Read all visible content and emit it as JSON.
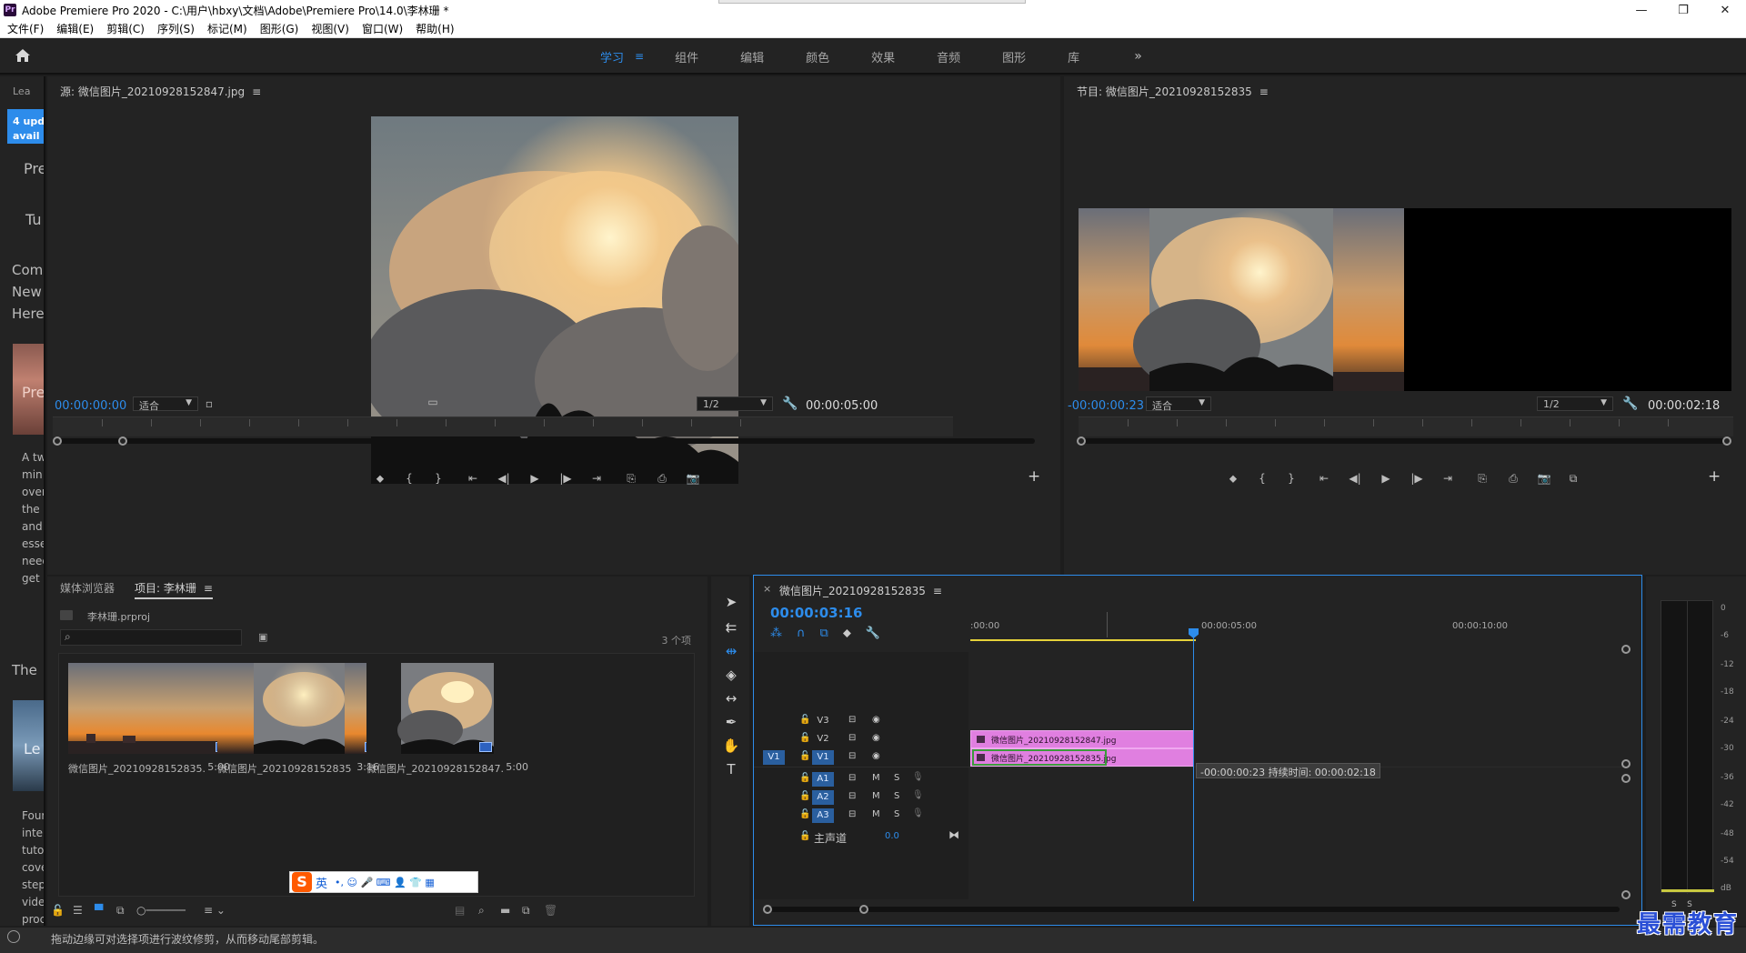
{
  "window": {
    "title": "Adobe Premiere Pro 2020 - C:\\用户\\hbxy\\文档\\Adobe\\Premiere Pro\\14.0\\李林珊 *",
    "app_icon": "Pr",
    "buttons": {
      "minimize": "—",
      "maximize": "❐",
      "close": "✕"
    }
  },
  "menubar": [
    "文件(F)",
    "编辑(E)",
    "剪辑(C)",
    "序列(S)",
    "标记(M)",
    "图形(G)",
    "视图(V)",
    "窗口(W)",
    "帮助(H)"
  ],
  "workspaces": {
    "home_icon": "home-icon",
    "tabs": [
      "学习",
      "组件",
      "编辑",
      "颜色",
      "效果",
      "音频",
      "图形",
      "库"
    ],
    "active": "学习",
    "active_menu": "≡",
    "more": "»"
  },
  "learn_panel": {
    "tab": "Lea",
    "updates_badge": "4 upd\navail",
    "texts": [
      "Pre",
      "Tu",
      "Com",
      "New",
      "Here",
      "Pre",
      "The",
      "Le"
    ],
    "desc1": "A tw\nmin\nover\nthe\nand\nesse\nneed\nget",
    "desc2": "Four\ninte\ntuto\ncove\nstep\nvide\nproc"
  },
  "source_monitor": {
    "title": "源: 微信图片_20210928152847.jpg",
    "menu": "≡",
    "timecode_in": "00:00:00:00",
    "fit": "适合",
    "resolution": "1/2",
    "duration": "00:00:05:00",
    "controls": [
      "⬥",
      "{",
      "}",
      "⇤",
      "◀|",
      "▶",
      "|▶",
      "⇥",
      "⎘",
      "⎙",
      "📷"
    ],
    "add": "+"
  },
  "program_monitor": {
    "title": "节目: 微信图片_20210928152835",
    "menu": "≡",
    "timecode_in": "-00:00:00:23",
    "fit": "适合",
    "resolution": "1/2",
    "duration": "00:00:02:18",
    "controls": [
      "⬥",
      "{",
      "}",
      "⇤",
      "◀|",
      "▶",
      "|▶",
      "⇥",
      "⎘",
      "⎙",
      "📷",
      "⧉"
    ],
    "add": "+"
  },
  "project_panel": {
    "tabs": [
      "媒体浏览器",
      "项目: 李林珊"
    ],
    "active_tab": "项目: 李林珊",
    "menu": "≡",
    "project_file": "李林珊.prproj",
    "search_placeholder": "",
    "item_count": "3 个项",
    "clips": [
      {
        "name": "微信图片_20210928152835...",
        "duration": "5:00"
      },
      {
        "name": "微信图片_20210928152835",
        "duration": "3:16"
      },
      {
        "name": "微信图片_20210928152847...",
        "duration": "5:00"
      }
    ]
  },
  "ime_bar": {
    "logo": "S",
    "lang": "英",
    "icons": "•, ☺ 🎤 ⌨ 👤 👕 ▦"
  },
  "tools": [
    "selection-tool",
    "track-select-tool",
    "ripple-edit-tool",
    "razor-tool",
    "slip-tool",
    "pen-tool",
    "hand-tool",
    "type-tool"
  ],
  "timeline": {
    "sequence_name": "微信图片_20210928152835",
    "menu": "≡",
    "close": "×",
    "timecode": "00:00:03:16",
    "ruler_labels": [
      ":00:00",
      "00:00:05:00",
      "00:00:10:00"
    ],
    "video_tracks": [
      {
        "id": "V3",
        "source": "",
        "selected": false
      },
      {
        "id": "V2",
        "source": "",
        "selected": false
      },
      {
        "id": "V1",
        "source": "V1",
        "selected": true
      }
    ],
    "audio_tracks": [
      {
        "id": "A1",
        "m": "M",
        "s": "S"
      },
      {
        "id": "A2",
        "m": "M",
        "s": "S"
      },
      {
        "id": "A3",
        "m": "M",
        "s": "S"
      }
    ],
    "master": {
      "label": "主声道",
      "value": "0.0"
    },
    "clips": [
      {
        "track": "V2",
        "name": "微信图片_20210928152847.jpg"
      },
      {
        "track": "V1",
        "name": "微信图片_20210928152835.jpg"
      }
    ],
    "tooltip": "-00:00:00:23 持续时间: 00:00:02:18"
  },
  "audio_meter": {
    "scale": [
      "0",
      "-6",
      "-12",
      "-18",
      "-24",
      "-30",
      "-36",
      "-42",
      "-48",
      "-54",
      "dB"
    ],
    "solo": [
      "S",
      "S"
    ]
  },
  "statusbar": {
    "message": "拖动边缘可对选择项进行波纹修剪，从而移动尾部剪辑。"
  },
  "watermark": "最需教育",
  "colors": {
    "accent": "#2d8ceb",
    "clip": "#e07fe0",
    "panel": "#232323",
    "bg": "#1d1d1d"
  }
}
